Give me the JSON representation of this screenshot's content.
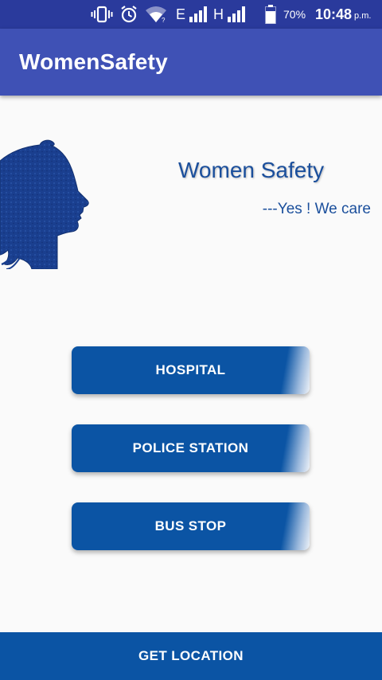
{
  "status_bar": {
    "network_e": "E",
    "network_h": "H",
    "battery_percent": "70%",
    "time": "10:48",
    "time_suffix": "p.m.",
    "icons": [
      "vibrate-icon",
      "alarm-icon",
      "wifi-icon",
      "signal-icon",
      "signal-icon",
      "battery-icon"
    ]
  },
  "app_bar": {
    "title": "WomenSafety"
  },
  "hero": {
    "title": "Women Safety",
    "tagline": "---Yes ! We care",
    "image": "woman-silhouette-icon"
  },
  "actions": {
    "hospital_label": "HOSPITAL",
    "police_label": "POLICE STATION",
    "bus_label": "BUS STOP"
  },
  "bottom": {
    "location_label": "GET LOCATION"
  },
  "colors": {
    "status_bar": "#2a3a9c",
    "app_bar": "#3f51b5",
    "button": "#0b54a4",
    "text_accent": "#1b4f9c",
    "background": "#fafafa"
  }
}
